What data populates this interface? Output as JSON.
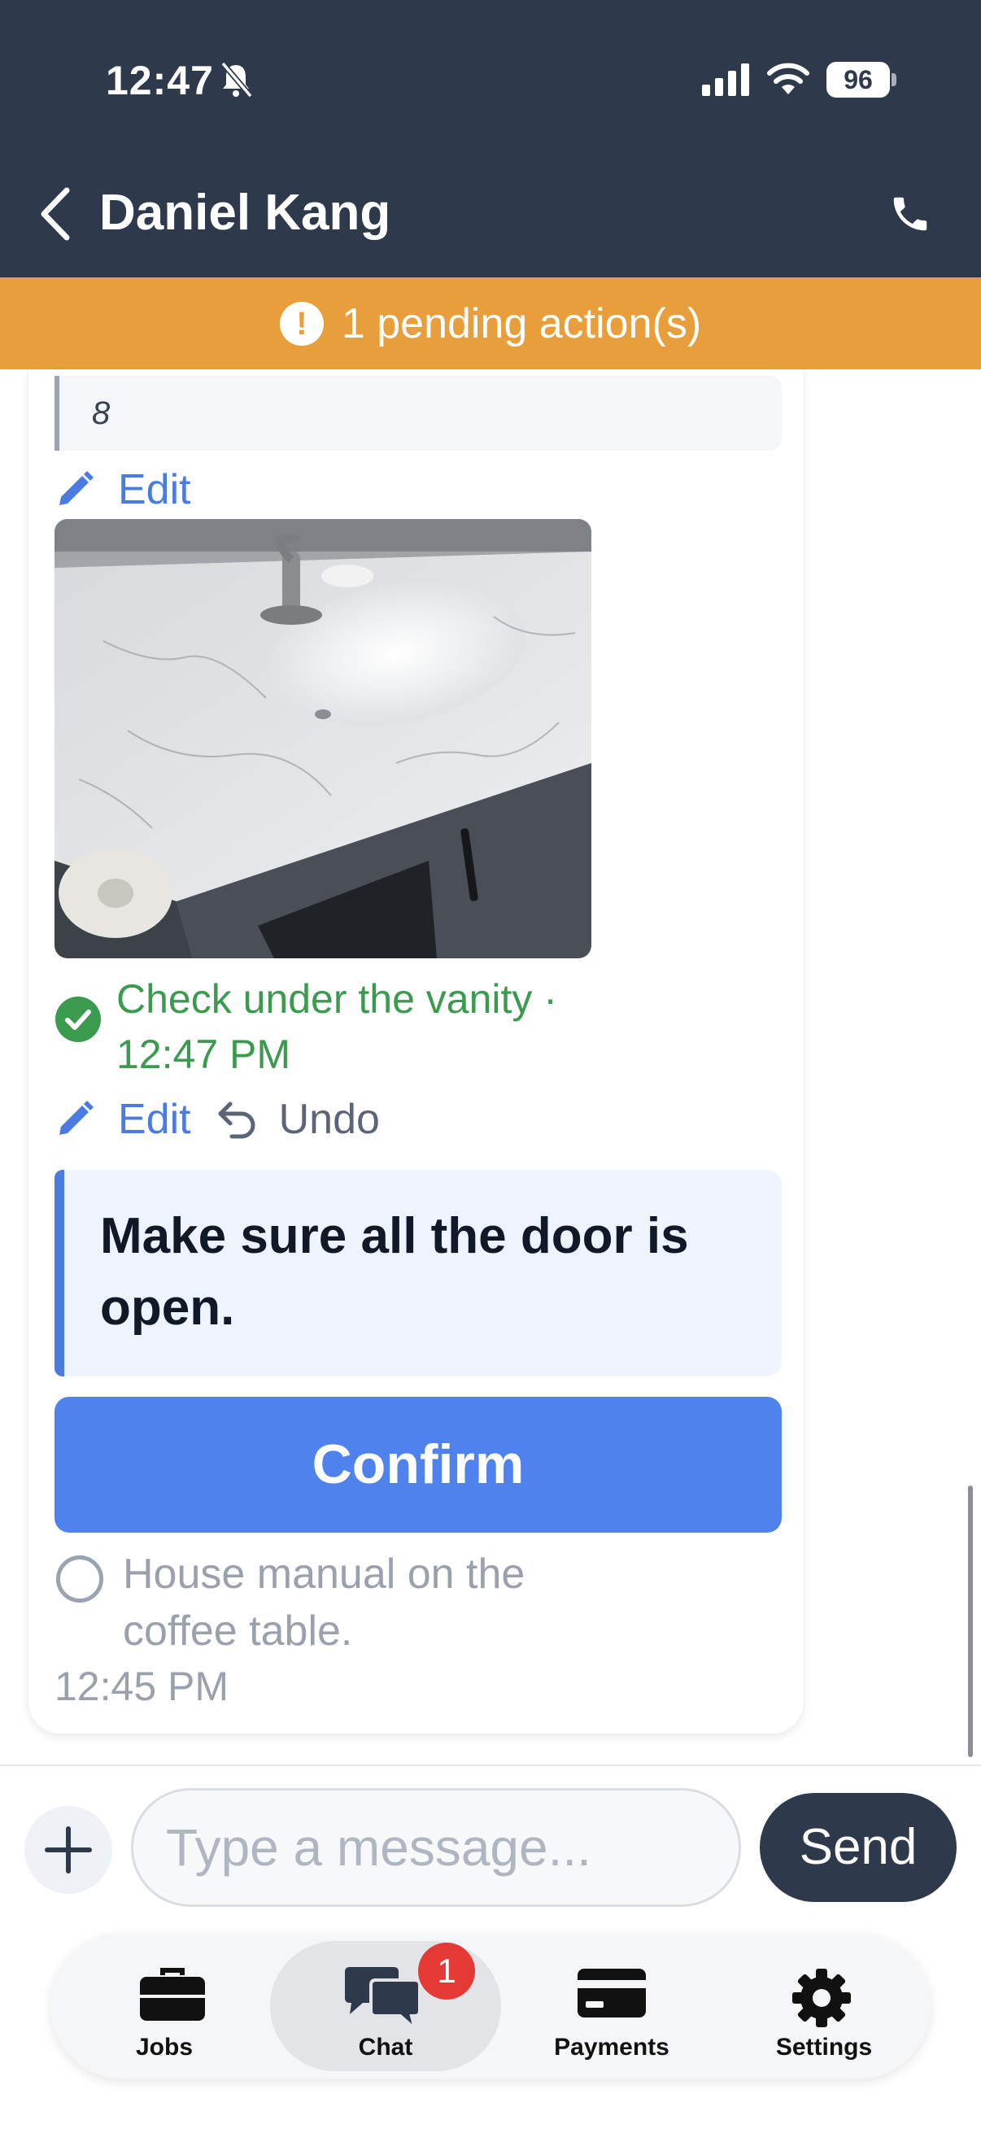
{
  "status_bar": {
    "time": "12:47",
    "battery": "96"
  },
  "header": {
    "contact_name": "Daniel Kang"
  },
  "pending": {
    "icon": "!",
    "text": "1 pending action(s)"
  },
  "chat": {
    "quote_top": "8",
    "edit_label": "Edit",
    "undo_label": "Undo",
    "check_item": "Check under the vanity · 12:47 PM",
    "instruction": "Make sure all the door is open.",
    "confirm_label": "Confirm",
    "todo_item": "House manual on the coffee table.",
    "timestamp": "12:45 PM"
  },
  "composer": {
    "placeholder": "Type a message...",
    "send_label": "Send"
  },
  "tabs": [
    {
      "label": "Jobs",
      "icon": "briefcase-icon"
    },
    {
      "label": "Chat",
      "icon": "chat-bubbles-icon",
      "badge": "1"
    },
    {
      "label": "Payments",
      "icon": "credit-card-icon"
    },
    {
      "label": "Settings",
      "icon": "gear-icon"
    }
  ],
  "colors": {
    "header": "#2e3a4b",
    "pending": "#e89e3b",
    "accent": "#4f82ec",
    "success": "#3a9a4d"
  }
}
